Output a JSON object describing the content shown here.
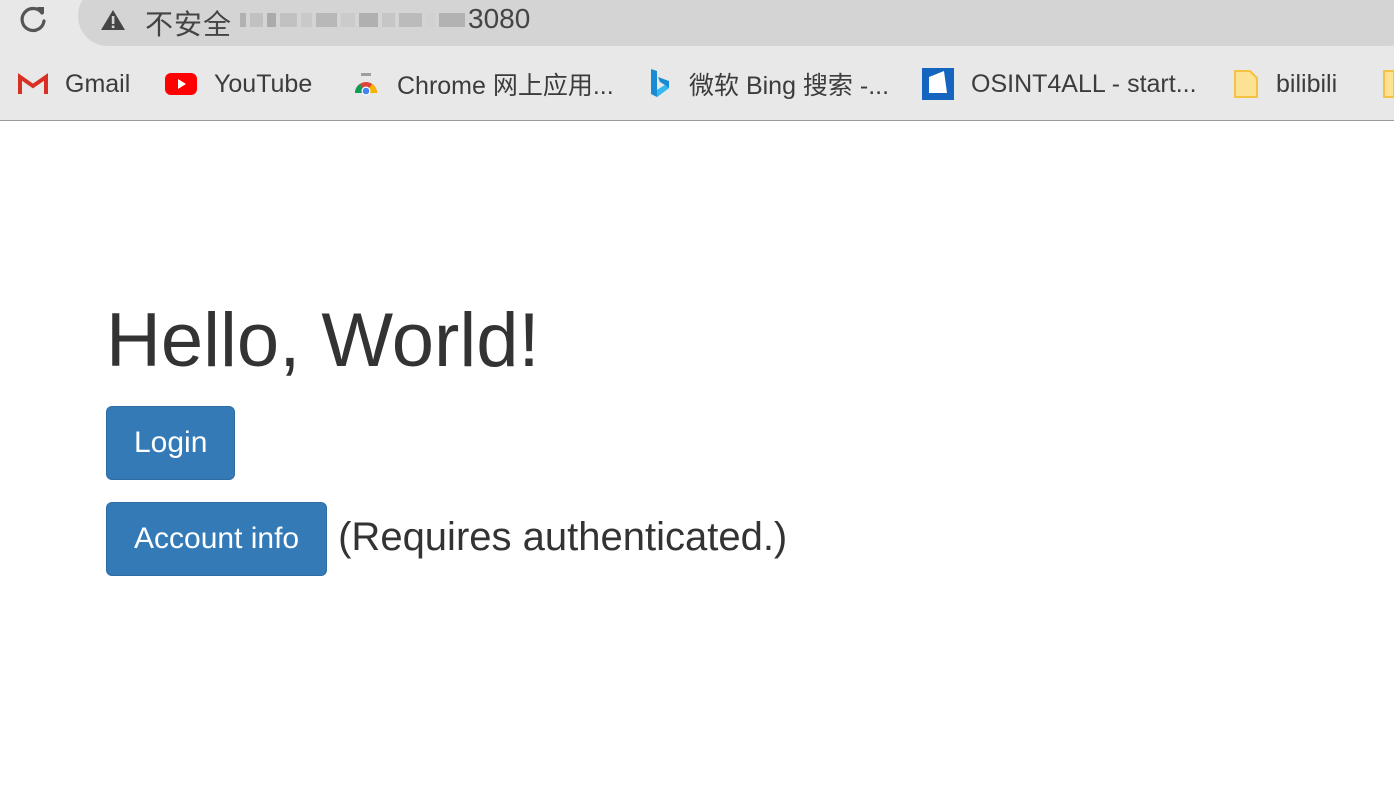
{
  "browser": {
    "security_label": "不安全",
    "url_visible_suffix": "3080",
    "bookmarks": [
      {
        "label": "Gmail",
        "icon": "gmail-icon"
      },
      {
        "label": "YouTube",
        "icon": "youtube-icon"
      },
      {
        "label": "Chrome 网上应用...",
        "icon": "chrome-web-store-icon"
      },
      {
        "label": "微软 Bing 搜索 -...",
        "icon": "bing-icon"
      },
      {
        "label": "OSINT4ALL - start...",
        "icon": "osint4all-icon"
      },
      {
        "label": "bilibili",
        "icon": "folder-icon"
      }
    ]
  },
  "page": {
    "heading": "Hello, World!",
    "login_button": "Login",
    "account_button": "Account info",
    "account_note": "(Requires authenticated.)"
  },
  "colors": {
    "button_bg": "#337ab7",
    "button_border": "#2e6da4",
    "text": "#333333"
  }
}
